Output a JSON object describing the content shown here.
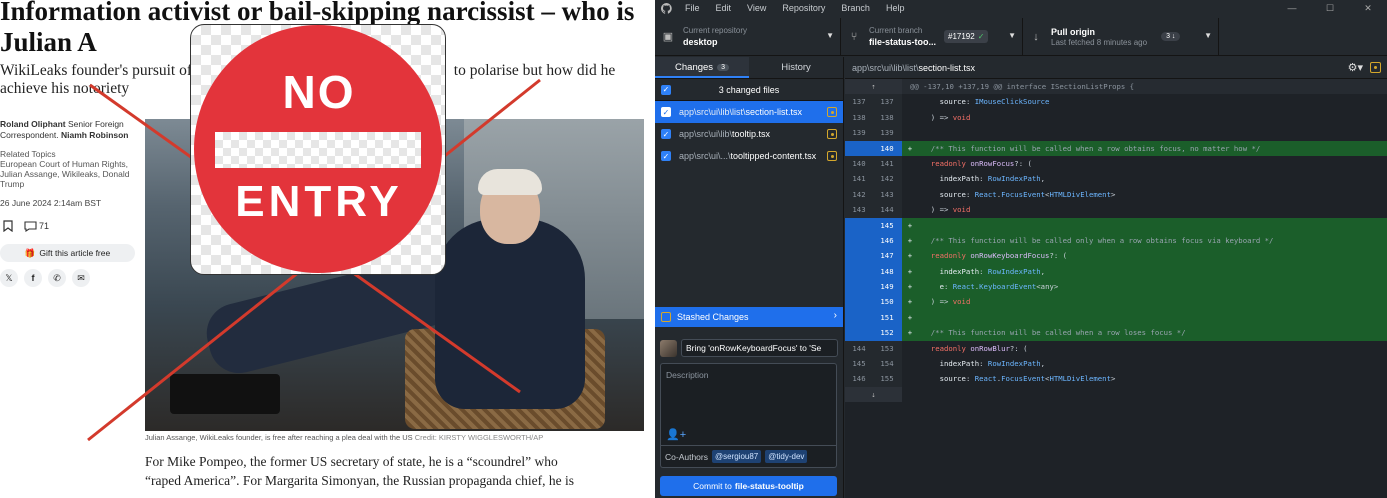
{
  "article": {
    "headline": "Information activist or bail-skipping narcissist – who is Julian A",
    "standfirst_left": "WikiLeaks founder's pursuit of",
    "standfirst_right": "to polarise but how did he",
    "standfirst_line2": "achieve his notoriety",
    "byline_name": "Roland Oliphant",
    "byline_role": "Senior Foreign Correspondent.",
    "byline_name2": "Niamh Robinson",
    "related_title": "Related Topics",
    "related_topics": "European Court of Human Rights, Julian Assange, Wikileaks, Donald Trump",
    "date": "26 June 2024 2:14am BST",
    "comment_count": "71",
    "gift_label": "Gift this article free",
    "caption": "Julian Assange, WikiLeaks founder, is free after reaching a plea deal with the US",
    "credit": "Credit: KIRSTY WIGGLESWORTH/AP",
    "body_line1": "For Mike Pompeo, the former US secretary of state, he is a “scoundrel” who",
    "body_line2": "“raped America”. For Margarita Simonyan, the Russian propaganda chief, he is",
    "cross_color": "#d33a2c"
  },
  "sign": {
    "top_text": "NO",
    "bottom_text": "ENTRY",
    "color": "#e3343b"
  },
  "app": {
    "menu": [
      "File",
      "Edit",
      "View",
      "Repository",
      "Branch",
      "Help"
    ],
    "repo_label": "Current repository",
    "repo_value": "desktop",
    "branch_label": "Current branch",
    "branch_value": "file-status-too...",
    "pr_number": "#17192",
    "fetch_label": "Pull origin",
    "fetch_sub": "Last fetched 8 minutes ago",
    "fetch_count": "3",
    "tabs": {
      "changes": "Changes",
      "changes_count": "3",
      "history": "History"
    },
    "changed_files_label": "3 changed files",
    "files": [
      {
        "dir": "app\\src\\ui\\lib\\list\\",
        "name": "section-list.tsx"
      },
      {
        "dir": "app\\src\\ui\\lib\\",
        "name": "tooltip.tsx"
      },
      {
        "dir": "app\\src\\ui\\...\\",
        "name": "tooltipped-content.tsx"
      }
    ],
    "stash_label": "Stashed Changes",
    "summary_value": "Bring 'onRowKeyboardFocus' to 'Se",
    "description_placeholder": "Description",
    "coauthors_label": "Co-Authors",
    "coauthors": [
      "@sergiou87",
      "@tidy-dev"
    ],
    "commit_prefix": "Commit to",
    "commit_branch": "file-status-tooltip",
    "accent": "#1f6feb"
  },
  "diff": {
    "path_dir": "app\\src\\ui\\lib\\list\\",
    "path_file": "section-list.tsx",
    "hunk": "@@ -137,10 +137,19 @@ interface ISectionListProps {",
    "lines": [
      {
        "old": "137",
        "new": "137",
        "type": "ctx",
        "text": "    source: IMouseClickSource"
      },
      {
        "old": "138",
        "new": "138",
        "type": "ctx",
        "text": "  ) => void"
      },
      {
        "old": "139",
        "new": "139",
        "type": "ctx",
        "text": ""
      },
      {
        "old": "",
        "new": "140",
        "type": "add",
        "text": "  /** This function will be called when a row obtains focus, no matter how */"
      },
      {
        "old": "140",
        "new": "141",
        "type": "ctx",
        "text": "  readonly onRowFocus?: ("
      },
      {
        "old": "141",
        "new": "142",
        "type": "ctx",
        "text": "    indexPath: RowIndexPath,"
      },
      {
        "old": "142",
        "new": "143",
        "type": "ctx",
        "text": "    source: React.FocusEvent<HTMLDivElement>"
      },
      {
        "old": "143",
        "new": "144",
        "type": "ctx",
        "text": "  ) => void"
      },
      {
        "old": "",
        "new": "145",
        "type": "add",
        "text": ""
      },
      {
        "old": "",
        "new": "146",
        "type": "add",
        "text": "  /** This function will be called only when a row obtains focus via keyboard */"
      },
      {
        "old": "",
        "new": "147",
        "type": "add",
        "text": "  readonly onRowKeyboardFocus?: ("
      },
      {
        "old": "",
        "new": "148",
        "type": "add",
        "text": "    indexPath: RowIndexPath,"
      },
      {
        "old": "",
        "new": "149",
        "type": "add",
        "text": "    e: React.KeyboardEvent<any>"
      },
      {
        "old": "",
        "new": "150",
        "type": "add",
        "text": "  ) => void"
      },
      {
        "old": "",
        "new": "151",
        "type": "add",
        "text": ""
      },
      {
        "old": "",
        "new": "152",
        "type": "add",
        "text": "  /** This function will be called when a row loses focus */"
      },
      {
        "old": "144",
        "new": "153",
        "type": "ctx",
        "text": "  readonly onRowBlur?: ("
      },
      {
        "old": "145",
        "new": "154",
        "type": "ctx",
        "text": "    indexPath: RowIndexPath,"
      },
      {
        "old": "146",
        "new": "155",
        "type": "ctx",
        "text": "    source: React.FocusEvent<HTMLDivElement>"
      }
    ]
  }
}
